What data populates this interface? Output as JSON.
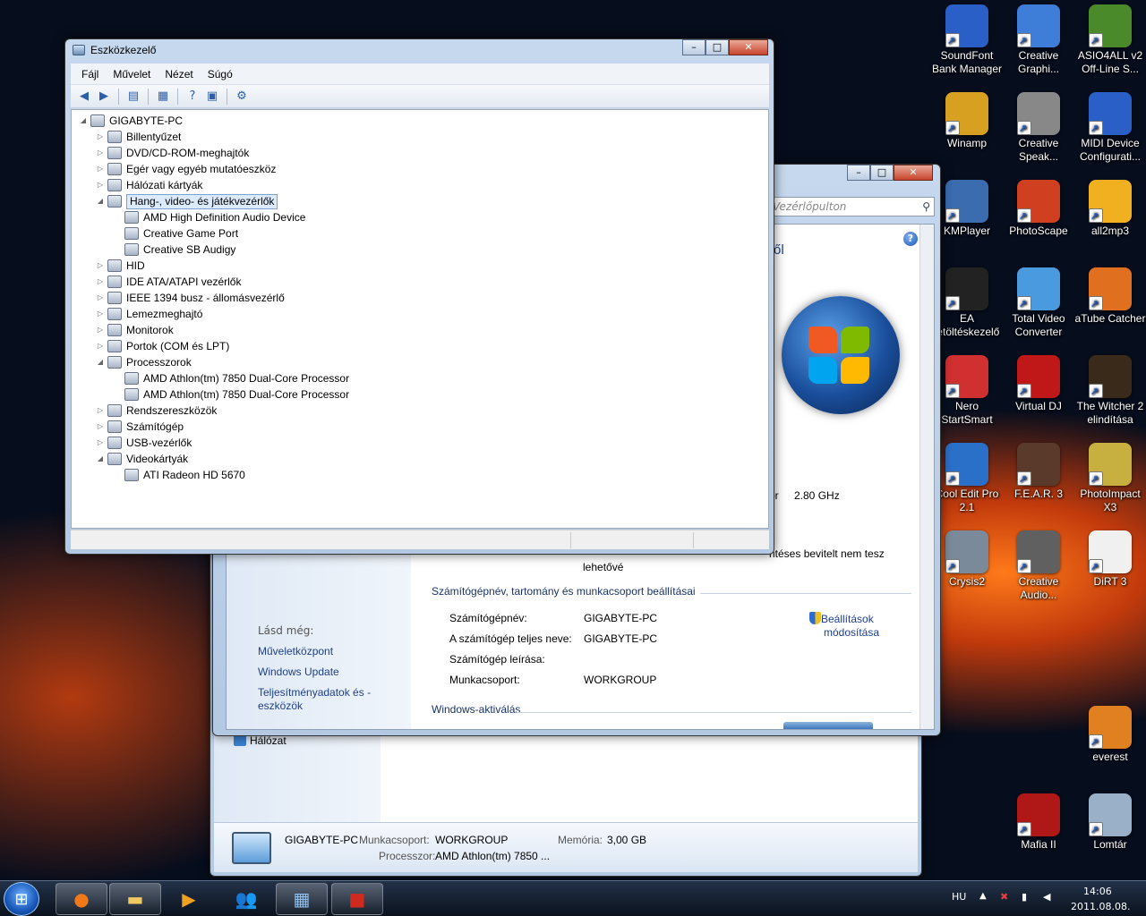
{
  "device_manager": {
    "title": "Eszközkezelő",
    "menu": [
      "Fájl",
      "Művelet",
      "Nézet",
      "Súgó"
    ],
    "tree": [
      {
        "label": "GIGABYTE-PC",
        "level": 0,
        "expanded": true
      },
      {
        "label": "Billentyűzet",
        "level": 1
      },
      {
        "label": "DVD/CD-ROM-meghajtók",
        "level": 1
      },
      {
        "label": "Egér vagy egyéb mutatóeszköz",
        "level": 1
      },
      {
        "label": "Hálózati kártyák",
        "level": 1
      },
      {
        "label": "Hang-, video- és játékvezérlők",
        "level": 1,
        "expanded": true,
        "selected": true
      },
      {
        "label": "AMD High Definition Audio Device",
        "level": 2
      },
      {
        "label": "Creative Game Port",
        "level": 2
      },
      {
        "label": "Creative SB Audigy",
        "level": 2
      },
      {
        "label": "HID",
        "level": 1
      },
      {
        "label": "IDE ATA/ATAPI vezérlők",
        "level": 1
      },
      {
        "label": "IEEE 1394 busz - állomásvezérlő",
        "level": 1
      },
      {
        "label": "Lemezmeghajtó",
        "level": 1
      },
      {
        "label": "Monitorok",
        "level": 1
      },
      {
        "label": "Portok (COM és LPT)",
        "level": 1
      },
      {
        "label": "Processzorok",
        "level": 1,
        "expanded": true
      },
      {
        "label": "AMD Athlon(tm) 7850 Dual-Core Processor",
        "level": 2
      },
      {
        "label": "AMD Athlon(tm) 7850 Dual-Core Processor",
        "level": 2
      },
      {
        "label": "Rendszereszközök",
        "level": 1
      },
      {
        "label": "Számítógép",
        "level": 1
      },
      {
        "label": "USB-vezérlők",
        "level": 1
      },
      {
        "label": "Videokártyák",
        "level": 1,
        "expanded": true
      },
      {
        "label": "ATI Radeon HD 5670",
        "level": 2
      }
    ]
  },
  "system_window": {
    "search_placeholder": "Vezérlőpulton",
    "heading_fragment": "ről",
    "processor_speed": "2.80 GHz",
    "processor_label_fragment": "or",
    "pen_text_1": "ntéses bevitelt nem tesz",
    "pen_text_2": "lehetővé",
    "see_also": "Lásd még:",
    "links": [
      "Műveletközpont",
      "Windows Update",
      "Teljesítményadatok és -eszközök"
    ],
    "section_computer": "Számítógépnév, tartomány és munkacsoport beállításai",
    "fields": [
      {
        "label": "Számítógépnév:",
        "value": "GIGABYTE-PC"
      },
      {
        "label": "A számítógép teljes neve:",
        "value": "GIGABYTE-PC"
      },
      {
        "label": "Számítógép leírása:",
        "value": ""
      },
      {
        "label": "Munkacsoport:",
        "value": "WORKGROUP"
      }
    ],
    "change_settings_1": "Beállítások",
    "change_settings_2": "módosítása",
    "section_activation": "Windows-aktiválás"
  },
  "back_window": {
    "network": "Hálózat",
    "pc_name": "GIGABYTE-PC",
    "workgroup_label": "Munkacsoport:",
    "workgroup_value": "WORKGROUP",
    "memory_label": "Memória:",
    "memory_value": "3,00 GB",
    "processor_label": "Processzor:",
    "processor_value": "AMD Athlon(tm) 7850 ..."
  },
  "desktop_icons": [
    {
      "label": "SoundFont Bank Manager",
      "color": "#2a5fc8"
    },
    {
      "label": "Creative Graphi...",
      "color": "#3e7ed8"
    },
    {
      "label": "ASIO4ALL v2 Off-Line S...",
      "color": "#4a8a2a"
    },
    {
      "label": "Winamp",
      "color": "#d8a020"
    },
    {
      "label": "Creative Speak...",
      "color": "#888888"
    },
    {
      "label": "MIDI Device Configurati...",
      "color": "#2a5fc8"
    },
    {
      "label": "KMPlayer",
      "color": "#3b6cb0"
    },
    {
      "label": "PhotoScape",
      "color": "#d04020"
    },
    {
      "label": "all2mp3",
      "color": "#f0b020"
    },
    {
      "label": "EA letöltéskezelő",
      "color": "#222222"
    },
    {
      "label": "Total Video Converter",
      "color": "#4a9ae0"
    },
    {
      "label": "aTube Catcher",
      "color": "#e07020"
    },
    {
      "label": "Nero StartSmart",
      "color": "#d03030"
    },
    {
      "label": "Virtual DJ",
      "color": "#c01818"
    },
    {
      "label": "The Witcher 2 elindítása",
      "color": "#3a2a1a"
    },
    {
      "label": "Cool Edit Pro 2.1",
      "color": "#2a70c8"
    },
    {
      "label": "F.E.A.R. 3",
      "color": "#5a3a2a"
    },
    {
      "label": "PhotoImpact X3",
      "color": "#c8b040"
    },
    {
      "label": "Crysis2",
      "color": "#7a8a9a"
    },
    {
      "label": "Creative Audio...",
      "color": "#606060"
    },
    {
      "label": "DiRT 3",
      "color": "#f0f0f0"
    },
    {
      "label": "everest",
      "color": "#e08020"
    },
    {
      "label": "Mafia II",
      "color": "#b01818"
    },
    {
      "label": "Lomtár",
      "color": "#9ab0c8"
    }
  ],
  "tray": {
    "language": "HU",
    "time": "14:06",
    "date": "2011.08.08."
  }
}
